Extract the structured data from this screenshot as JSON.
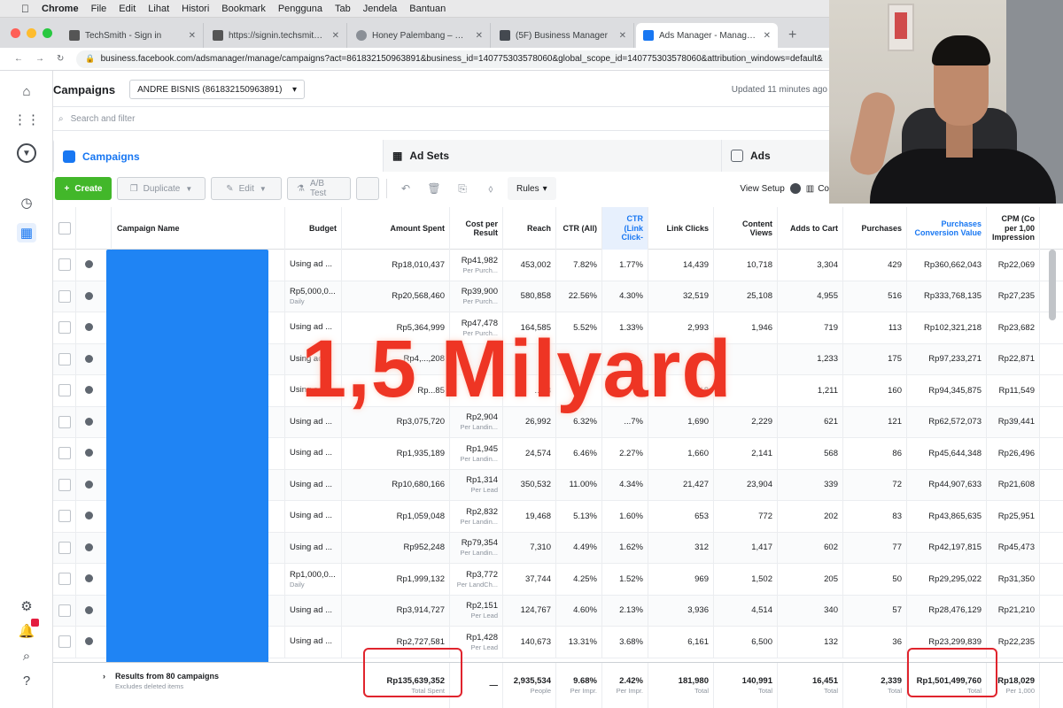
{
  "menubar": {
    "items": [
      "Chrome",
      "File",
      "Edit",
      "Lihat",
      "Histori",
      "Bookmark",
      "Pengguna",
      "Tab",
      "Jendela",
      "Bantuan"
    ]
  },
  "browser": {
    "tabs": [
      {
        "title": "TechSmith - Sign in"
      },
      {
        "title": "https://signin.techsmith.com"
      },
      {
        "title": "Honey Palembang – Honey Pr..."
      },
      {
        "title": "(5F) Business Manager"
      },
      {
        "title": "Ads Manager - Manage Ads"
      }
    ],
    "active_tab": 4,
    "url": "business.facebook.com/adsmanager/manage/campaigns?act=861832150963891&business_id=140775303578060&global_scope_id=140775303578060&attribution_windows=default&"
  },
  "header": {
    "title": "Campaigns",
    "account": "ANDRE BISNIS (861832150963891)",
    "updated": "Updated 11 minutes ago"
  },
  "search": {
    "placeholder": "Search and filter"
  },
  "level_tabs": {
    "campaigns": "Campaigns",
    "adsets": "Ad Sets",
    "ads": "Ads"
  },
  "toolbar": {
    "create": "Create",
    "duplicate": "Duplicate",
    "edit": "Edit",
    "ab_test": "A/B Test",
    "rules": "Rules",
    "view_setup": "View Setup",
    "columns": "Co"
  },
  "table": {
    "columns": {
      "name": "Campaign Name",
      "budget": "Budget",
      "spent": "Amount Spent",
      "cpr": "Cost per Result",
      "reach": "Reach",
      "ctr_all": "CTR (All)",
      "ctr_link": "CTR (Link Click-",
      "clicks": "Link Clicks",
      "views": "Content Views",
      "cart": "Adds to Cart",
      "purchases": "Purchases",
      "conv_value": "Purchases Conversion Value",
      "cpm": "CPM (Co per 1,00 Impression"
    },
    "rows": [
      {
        "budget": "Using ad ...",
        "budget_sub": "",
        "spent": "Rp18,010,437",
        "cpr": "Rp41,982",
        "cpr_sub": "Per Purch...",
        "reach": "453,002",
        "ctr_all": "7.82%",
        "ctr_link": "1.77%",
        "clicks": "14,439",
        "views": "10,718",
        "cart": "3,304",
        "purchases": "429",
        "conv_value": "Rp360,662,043",
        "cpm": "Rp22,069"
      },
      {
        "budget": "Rp5,000,0...",
        "budget_sub": "Daily",
        "spent": "Rp20,568,460",
        "cpr": "Rp39,900",
        "cpr_sub": "Per Purch...",
        "reach": "580,858",
        "ctr_all": "22.56%",
        "ctr_link": "4.30%",
        "clicks": "32,519",
        "views": "25,108",
        "cart": "4,955",
        "purchases": "516",
        "conv_value": "Rp333,768,135",
        "cpm": "Rp27,235"
      },
      {
        "budget": "Using ad ...",
        "budget_sub": "",
        "spent": "Rp5,364,999",
        "cpr": "Rp47,478",
        "cpr_sub": "Per Purch...",
        "reach": "164,585",
        "ctr_all": "5.52%",
        "ctr_link": "1.33%",
        "clicks": "2,993",
        "views": "1,946",
        "cart": "719",
        "purchases": "113",
        "conv_value": "Rp102,321,218",
        "cpm": "Rp23,682"
      },
      {
        "budget": "Using ad ...",
        "budget_sub": "",
        "spent": "Rp4,...,208",
        "cpr": "",
        "cpr_sub": "",
        "reach": "",
        "ctr_all": "",
        "ctr_link": "2.1...",
        "clicks": "...965",
        "views": "",
        "cart": "1,233",
        "purchases": "175",
        "conv_value": "Rp97,233,271",
        "cpm": "Rp22,871"
      },
      {
        "budget": "Using ad ...",
        "budget_sub": "",
        "spent": "Rp...85",
        "cpr": "",
        "cpr_sub": "",
        "reach": "...53",
        "ctr_all": "",
        "ctr_link": "",
        "clicks": "...18",
        "views": "",
        "cart": "1,211",
        "purchases": "160",
        "conv_value": "Rp94,345,875",
        "cpm": "Rp11,549"
      },
      {
        "budget": "Using ad ...",
        "budget_sub": "",
        "spent": "Rp3,075,720",
        "cpr": "Rp2,904",
        "cpr_sub": "Per Landin...",
        "reach": "26,992",
        "ctr_all": "6.32%",
        "ctr_link": "...7%",
        "clicks": "1,690",
        "views": "2,229",
        "cart": "621",
        "purchases": "121",
        "conv_value": "Rp62,572,073",
        "cpm": "Rp39,441"
      },
      {
        "budget": "Using ad ...",
        "budget_sub": "",
        "spent": "Rp1,935,189",
        "cpr": "Rp1,945",
        "cpr_sub": "Per Landin...",
        "reach": "24,574",
        "ctr_all": "6.46%",
        "ctr_link": "2.27%",
        "clicks": "1,660",
        "views": "2,141",
        "cart": "568",
        "purchases": "86",
        "conv_value": "Rp45,644,348",
        "cpm": "Rp26,496"
      },
      {
        "budget": "Using ad ...",
        "budget_sub": "",
        "spent": "Rp10,680,166",
        "cpr": "Rp1,314",
        "cpr_sub": "Per Lead",
        "reach": "350,532",
        "ctr_all": "11.00%",
        "ctr_link": "4.34%",
        "clicks": "21,427",
        "views": "23,904",
        "cart": "339",
        "purchases": "72",
        "conv_value": "Rp44,907,633",
        "cpm": "Rp21,608"
      },
      {
        "budget": "Using ad ...",
        "budget_sub": "",
        "spent": "Rp1,059,048",
        "cpr": "Rp2,832",
        "cpr_sub": "Per Landin...",
        "reach": "19,468",
        "ctr_all": "5.13%",
        "ctr_link": "1.60%",
        "clicks": "653",
        "views": "772",
        "cart": "202",
        "purchases": "83",
        "conv_value": "Rp43,865,635",
        "cpm": "Rp25,951"
      },
      {
        "budget": "Using ad ...",
        "budget_sub": "",
        "spent": "Rp952,248",
        "cpr": "Rp79,354",
        "cpr_sub": "Per Landin...",
        "reach": "7,310",
        "ctr_all": "4.49%",
        "ctr_link": "1.62%",
        "clicks": "312",
        "views": "1,417",
        "cart": "602",
        "purchases": "77",
        "conv_value": "Rp42,197,815",
        "cpm": "Rp45,473"
      },
      {
        "budget": "Rp1,000,0...",
        "budget_sub": "Daily",
        "spent": "Rp1,999,132",
        "cpr": "Rp3,772",
        "cpr_sub": "Per LandCh...",
        "reach": "37,744",
        "ctr_all": "4.25%",
        "ctr_link": "1.52%",
        "clicks": "969",
        "views": "1,502",
        "cart": "205",
        "purchases": "50",
        "conv_value": "Rp29,295,022",
        "cpm": "Rp31,350"
      },
      {
        "budget": "Using ad ...",
        "budget_sub": "",
        "spent": "Rp3,914,727",
        "cpr": "Rp2,151",
        "cpr_sub": "Per Lead",
        "reach": "124,767",
        "ctr_all": "4.60%",
        "ctr_link": "2.13%",
        "clicks": "3,936",
        "views": "4,514",
        "cart": "340",
        "purchases": "57",
        "conv_value": "Rp28,476,129",
        "cpm": "Rp21,210"
      },
      {
        "budget": "Using ad ...",
        "budget_sub": "",
        "spent": "Rp2,727,581",
        "cpr": "Rp1,428",
        "cpr_sub": "Per Lead",
        "reach": "140,673",
        "ctr_all": "13.31%",
        "ctr_link": "3.68%",
        "clicks": "6,161",
        "views": "6,500",
        "cart": "132",
        "purchases": "36",
        "conv_value": "Rp23,299,839",
        "cpm": "Rp22,235"
      }
    ],
    "totals": {
      "label": "Results from 80 campaigns",
      "label_sub": "Excludes deleted items",
      "spent": "Rp135,639,352",
      "spent_sub": "Total Spent",
      "cpr": "—",
      "reach": "2,935,534",
      "reach_sub": "People",
      "ctr_all": "9.68%",
      "ctr_all_sub": "Per Impr.",
      "ctr_link": "2.42%",
      "ctr_link_sub": "Per Impr.",
      "clicks": "181,980",
      "clicks_sub": "Total",
      "views": "140,991",
      "views_sub": "Total",
      "cart": "16,451",
      "cart_sub": "Total",
      "purchases": "2,339",
      "purchases_sub": "Total",
      "conv_value": "Rp1,501,499,760",
      "conv_value_sub": "Total",
      "cpm": "Rp18,029",
      "cpm_sub": "Per 1,000"
    }
  },
  "overlay": {
    "text": "1,5 Milyard"
  },
  "colors": {
    "brand_blue": "#1877f2",
    "create_green": "#42b72a",
    "highlight_red": "#e0242d",
    "overlay_red": "#ee3524",
    "redaction_blue": "#1f84f4"
  }
}
